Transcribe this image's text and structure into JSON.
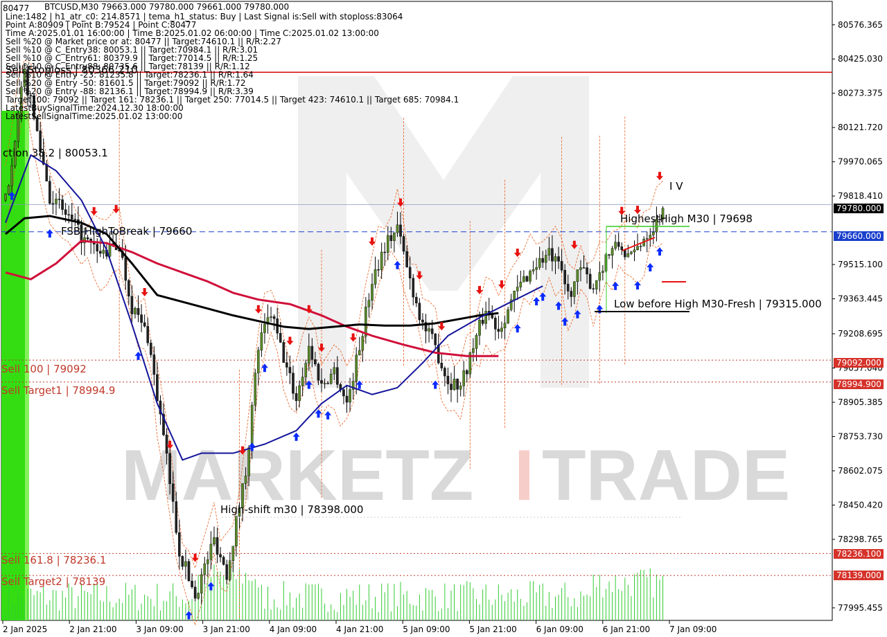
{
  "header": {
    "symbol_line": "BTCUSD,M30  79663.000 79780.000 79661.000 79780.000",
    "price_overlay": "80477",
    "info_lines": [
      "Line:1482 | h1_atr_c0: 214.8571 | tema_h1_status: Buy | Last Signal is:Sell with stoploss:83064",
      "Point A:80909 | Point B:79524 | Point C:80477",
      "Time A:2025.01.01 16:00:00 | Time B:2025.01.02 06:00:00 | Time C:2025.01.02 13:00:00",
      "Sell %20 @ Market price or at: 80477 || Target:74610.1 || R/R:2.27",
      "Sell %10 @ C_Entry38: 80053.1 || Target:70984.1 || R/R:3.01",
      "Sell %10 @ C_Entry61: 80379.9 || Target:77014.5 || R/R:1.25",
      "Sell %10 @ C_Entry88: 80735.6 || Target:78139 || R/R:1.12",
      "Sell %10 @ Entry -23: 81235.8 || Target:78236.1 || R/R:1.64",
      "Sell %20 @ Entry -50: 81601.5 || Target:79092 || R/R:1.72",
      "Sell %20 @ Entry -88: 82136.1 || Target:78994.9 || R/R:3.39",
      "Target100: 79092 || Target 161: 78236.1 || Target 250: 77014.5 || Target 423: 74610.1 || Target 685: 70984.1",
      "LatestBuySignalTime:2024.12.30 18:00:00",
      "LatestSellSignalTime:2025.01.02 13:00:00"
    ],
    "stoploss_overlay": "Sell Stoploss | 80366.210"
  },
  "annotations": {
    "wave_label": "I V",
    "highest_high": "HighestHigh   M30 | 79698",
    "low_before_high": "Low before High   M30-Fresh | 79315.000",
    "high_shift": "High-shift m30 | 78398.000",
    "fsb": "FSB-HighToBreak | 79660",
    "fib_label": "ction 38.2 | 80053.1"
  },
  "levels": {
    "sell100": "Sell 100 | 79092",
    "sell_target1": "Sell Target1 | 78994.9",
    "sell161": "Sell 161.8 | 78236.1",
    "sell_target2": "Sell Target2 | 78139"
  },
  "badges": {
    "current": "79780.000",
    "fsb": "79660.000",
    "sell100": "79092.000",
    "sell_target1": "78994.900",
    "sell161": "78236.100",
    "sell_target2": "78139.000"
  },
  "watermark": {
    "left": "MARKETZ",
    "mid": "I",
    "right": "TRADE"
  },
  "colors": {
    "sell_level": "#c0392b",
    "stoploss_line": "#d40000",
    "fsb_line": "#1a3fcc",
    "blue_ma": "#14149b",
    "red_ma": "#d0103a",
    "black_ma": "#000000",
    "buy_arrow": "#0a2bff",
    "sell_arrow": "#e8110f",
    "volume": "#33cc33",
    "green_band": "#33dd11",
    "badge_red": "#d5322a",
    "badge_blue": "#1a3fcc"
  },
  "chart_data": {
    "type": "candlestick",
    "symbol": "BTCUSD",
    "timeframe": "M30",
    "y_ticks": [
      "80576.365",
      "80425.030",
      "80273.375",
      "80121.720",
      "79970.065",
      "79818.410",
      "79515.100",
      "79363.445",
      "79208.695",
      "79057.040",
      "78905.385",
      "78753.730",
      "78602.075",
      "78450.420",
      "78298.765",
      "77995.455"
    ],
    "ylim": [
      77940,
      80680
    ],
    "x_ticks": [
      "2 Jan 2025",
      "2 Jan 21:00",
      "3 Jan 09:00",
      "3 Jan 21:00",
      "4 Jan 09:00",
      "4 Jan 21:00",
      "5 Jan 09:00",
      "5 Jan 21:00",
      "6 Jan 09:00",
      "6 Jan 21:00",
      "7 Jan 09:00"
    ],
    "last_price": 79780.0,
    "fsb_high_to_break": 79660,
    "stoploss": 80366.21,
    "levels": [
      79092,
      78994.9,
      78236.1,
      78139
    ],
    "close_path": [
      [
        0,
        79800
      ],
      [
        6,
        80360
      ],
      [
        10,
        80100
      ],
      [
        14,
        79820
      ],
      [
        20,
        79720
      ],
      [
        25,
        79620
      ],
      [
        30,
        79560
      ],
      [
        36,
        79600
      ],
      [
        40,
        79330
      ],
      [
        45,
        79200
      ],
      [
        50,
        78750
      ],
      [
        55,
        78250
      ],
      [
        60,
        78050
      ],
      [
        66,
        78300
      ],
      [
        70,
        78150
      ],
      [
        76,
        78600
      ],
      [
        80,
        79150
      ],
      [
        84,
        79300
      ],
      [
        88,
        79100
      ],
      [
        92,
        78920
      ],
      [
        96,
        79150
      ],
      [
        100,
        78980
      ],
      [
        104,
        79050
      ],
      [
        108,
        78900
      ],
      [
        112,
        79150
      ],
      [
        116,
        79450
      ],
      [
        120,
        79600
      ],
      [
        124,
        79680
      ],
      [
        128,
        79450
      ],
      [
        132,
        79250
      ],
      [
        136,
        79150
      ],
      [
        140,
        79000
      ],
      [
        144,
        78980
      ],
      [
        148,
        79150
      ],
      [
        152,
        79320
      ],
      [
        156,
        79230
      ],
      [
        160,
        79350
      ],
      [
        164,
        79450
      ],
      [
        168,
        79520
      ],
      [
        172,
        79560
      ],
      [
        176,
        79480
      ],
      [
        178,
        79380
      ],
      [
        182,
        79490
      ],
      [
        186,
        79420
      ],
      [
        190,
        79550
      ],
      [
        194,
        79600
      ],
      [
        198,
        79540
      ],
      [
        202,
        79640
      ],
      [
        206,
        79700
      ],
      [
        208,
        79780
      ]
    ],
    "blue_ma": [
      [
        0,
        79700
      ],
      [
        8,
        80000
      ],
      [
        16,
        79930
      ],
      [
        24,
        79800
      ],
      [
        32,
        79580
      ],
      [
        40,
        79250
      ],
      [
        48,
        78900
      ],
      [
        56,
        78650
      ],
      [
        62,
        78680
      ],
      [
        72,
        78680
      ],
      [
        82,
        78720
      ],
      [
        92,
        78780
      ],
      [
        100,
        78900
      ],
      [
        108,
        78980
      ],
      [
        116,
        78940
      ],
      [
        124,
        78970
      ],
      [
        132,
        79080
      ],
      [
        140,
        79200
      ],
      [
        150,
        79280
      ],
      [
        160,
        79350
      ],
      [
        170,
        79420
      ]
    ],
    "red_ma": [
      [
        0,
        79480
      ],
      [
        8,
        79450
      ],
      [
        16,
        79520
      ],
      [
        24,
        79620
      ],
      [
        32,
        79610
      ],
      [
        40,
        79570
      ],
      [
        48,
        79520
      ],
      [
        56,
        79480
      ],
      [
        64,
        79440
      ],
      [
        72,
        79390
      ],
      [
        80,
        79360
      ],
      [
        90,
        79340
      ],
      [
        100,
        79290
      ],
      [
        108,
        79240
      ],
      [
        116,
        79200
      ],
      [
        126,
        79160
      ],
      [
        136,
        79125
      ],
      [
        146,
        79110
      ],
      [
        156,
        79110
      ]
    ],
    "black_ma": [
      [
        0,
        79650
      ],
      [
        6,
        79720
      ],
      [
        14,
        79730
      ],
      [
        24,
        79700
      ],
      [
        32,
        79650
      ],
      [
        40,
        79520
      ],
      [
        48,
        79380
      ],
      [
        56,
        79350
      ],
      [
        64,
        79320
      ],
      [
        72,
        79290
      ],
      [
        80,
        79265
      ],
      [
        88,
        79240
      ],
      [
        96,
        79230
      ],
      [
        104,
        79240
      ],
      [
        112,
        79250
      ],
      [
        120,
        79245
      ],
      [
        128,
        79245
      ],
      [
        136,
        79255
      ],
      [
        144,
        79275
      ],
      [
        150,
        79290
      ],
      [
        156,
        79300
      ]
    ],
    "buy_arrow_bars": [
      2,
      14,
      42,
      58,
      65,
      78,
      82,
      92,
      96,
      99,
      102,
      112,
      124,
      136,
      162,
      168,
      170,
      175,
      177,
      181,
      188,
      193,
      200,
      204,
      207
    ],
    "sell_arrow_bars": [
      28,
      35,
      44,
      52,
      60,
      75,
      80,
      90,
      96,
      100,
      110,
      116,
      125,
      131,
      138,
      150,
      157,
      162,
      180,
      195,
      200,
      207
    ]
  }
}
